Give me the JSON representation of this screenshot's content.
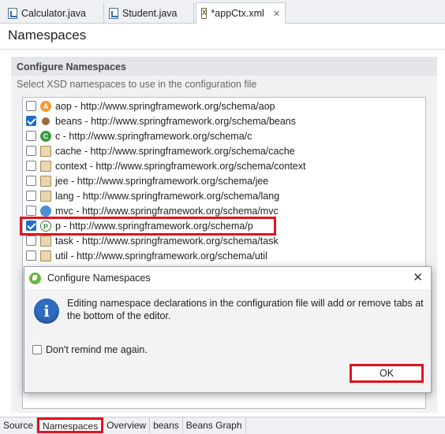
{
  "editor_tabs": [
    {
      "label": "Calculator.java",
      "icon": "java-file-icon"
    },
    {
      "label": "Student.java",
      "icon": "java-file-icon"
    },
    {
      "label": "*appCtx.xml",
      "icon": "xml-file-icon",
      "close": "✕"
    }
  ],
  "page": {
    "title": "Namespaces"
  },
  "section": {
    "heading": "Configure Namespaces",
    "description": "Select XSD namespaces to use in the configuration file"
  },
  "namespaces": [
    {
      "label": "aop - http://www.springframework.org/schema/aop",
      "checked": false,
      "icon": "aop-icon"
    },
    {
      "label": "beans - http://www.springframework.org/schema/beans",
      "checked": true,
      "icon": "beans-icon"
    },
    {
      "label": "c - http://www.springframework.org/schema/c",
      "checked": false,
      "icon": "c-namespace-icon"
    },
    {
      "label": "cache - http://www.springframework.org/schema/cache",
      "checked": false,
      "icon": "cache-icon"
    },
    {
      "label": "context - http://www.springframework.org/schema/context",
      "checked": false,
      "icon": "context-icon"
    },
    {
      "label": "jee - http://www.springframework.org/schema/jee",
      "checked": false,
      "icon": "jee-icon"
    },
    {
      "label": "lang - http://www.springframework.org/schema/lang",
      "checked": false,
      "icon": "lang-icon"
    },
    {
      "label": "mvc - http://www.springframework.org/schema/mvc",
      "checked": false,
      "icon": "mvc-globe-icon"
    },
    {
      "label": "p - http://www.springframework.org/schema/p",
      "checked": true,
      "icon": "p-namespace-icon"
    },
    {
      "label": "task - http://www.springframework.org/schema/task",
      "checked": false,
      "icon": "task-icon"
    },
    {
      "label": "util - http://www.springframework.org/schema/util",
      "checked": false,
      "icon": "util-icon"
    }
  ],
  "bottom_tabs": [
    "Source",
    "Namespaces",
    "Overview",
    "beans",
    "Beans Graph"
  ],
  "dialog": {
    "title": "Configure Namespaces",
    "message": "Editing namespace declarations in the configuration file will add or remove tabs at the bottom of the editor.",
    "checkbox_label": "Don't remind me again.",
    "ok_label": "OK",
    "close": "✕"
  },
  "colors": {
    "highlight": "#e2121d",
    "accent": "#1f6fc8"
  }
}
